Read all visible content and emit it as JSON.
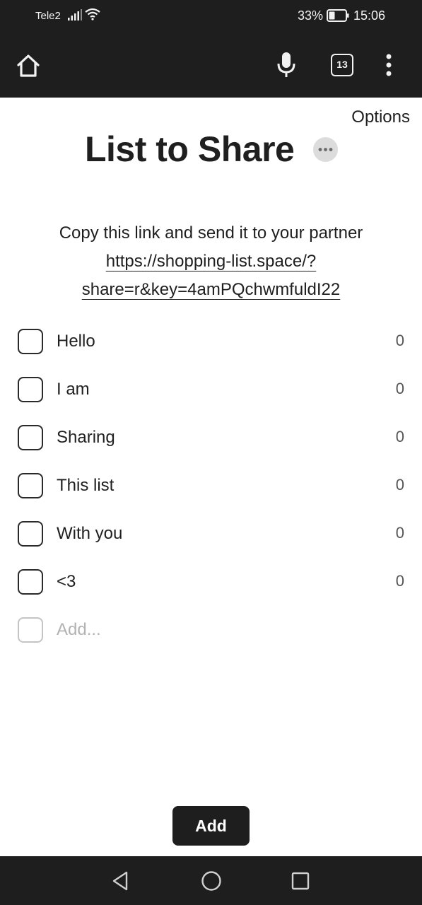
{
  "status_bar": {
    "carrier": "Tele2",
    "battery": "33%",
    "time": "15:06"
  },
  "browser": {
    "tab_count": "13",
    "icons": [
      "home-icon",
      "microphone-icon",
      "tabs-icon",
      "more-vertical-icon"
    ]
  },
  "page": {
    "options_label": "Options",
    "title": "List to Share",
    "share": {
      "instruction": "Copy this link and send it to your partner",
      "link_line1": "https://shopping-list.space/?",
      "link_line2": "share=r&key=4amPQchwmfuldI22"
    },
    "items": [
      {
        "label": "Hello",
        "count": "0"
      },
      {
        "label": "I am",
        "count": "0"
      },
      {
        "label": "Sharing",
        "count": "0"
      },
      {
        "label": "This list",
        "count": "0"
      },
      {
        "label": "With you",
        "count": "0"
      },
      {
        "label": "<3",
        "count": "0"
      }
    ],
    "add_placeholder": "Add...",
    "add_button_label": "Add"
  },
  "nav_bar": {
    "icons": [
      "back-icon",
      "home-circle-icon",
      "recents-icon"
    ]
  }
}
